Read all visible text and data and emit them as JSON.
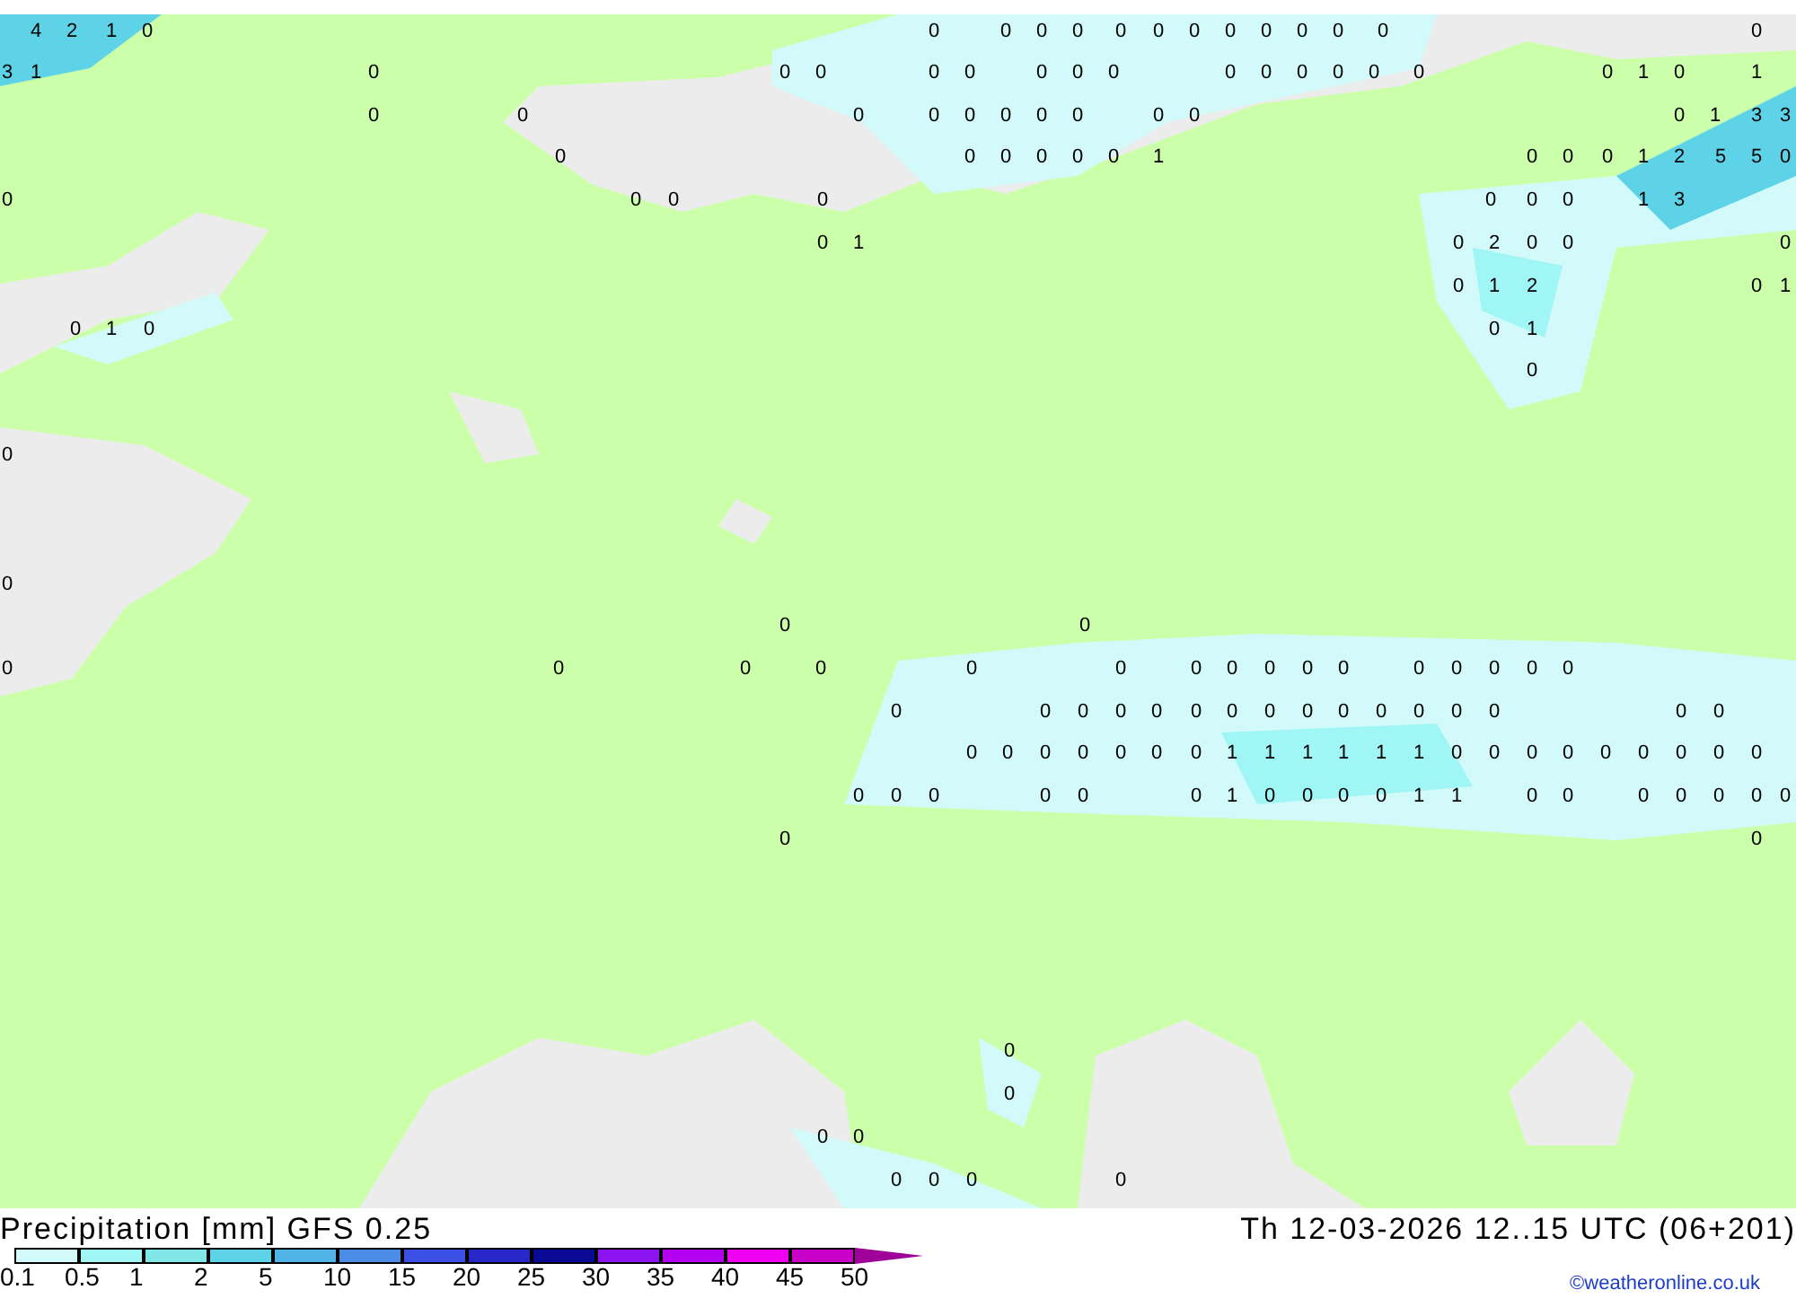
{
  "map_values": [
    {
      "values": [
        "4",
        "2",
        "1",
        "0",
        "0",
        "0",
        "0",
        "0",
        "0",
        "0",
        "0",
        "0",
        "0",
        "0",
        "0",
        "0",
        "0"
      ]
    },
    {
      "values": [
        "3",
        "1",
        "0",
        "0",
        "0",
        "0",
        "0",
        "0",
        "0",
        "0",
        "0",
        "0",
        "0",
        "0",
        "0",
        "0",
        "0",
        "1",
        "0",
        "1"
      ]
    },
    {
      "values": [
        "0",
        "0",
        "0",
        "0",
        "0",
        "0",
        "0",
        "0",
        "0",
        "0",
        "0",
        "1",
        "3",
        "3"
      ]
    },
    {
      "values": [
        "0",
        "0",
        "0",
        "0",
        "0",
        "0",
        "1",
        "0",
        "0",
        "0",
        "1",
        "2",
        "5",
        "5",
        "0"
      ]
    },
    {
      "values": [
        "0",
        "0",
        "0",
        "0",
        "0",
        "0",
        "0",
        "1",
        "3"
      ]
    },
    {
      "values": [
        "0",
        "1",
        "0",
        "2",
        "0",
        "0",
        "0"
      ]
    },
    {
      "values": [
        "0",
        "1",
        "2",
        "0",
        "1"
      ]
    },
    {
      "values": [
        "0",
        "1",
        "0",
        "0",
        "1"
      ]
    },
    {
      "values": [
        "0"
      ]
    },
    {
      "values": [
        "0"
      ]
    },
    {
      "values": [
        "0"
      ]
    },
    {
      "values": [
        "0",
        "0"
      ]
    },
    {
      "values": [
        "0",
        "0",
        "0",
        "0",
        "0",
        "0",
        "0",
        "0",
        "0",
        "0",
        "0",
        "0",
        "0",
        "0",
        "0",
        "0"
      ]
    },
    {
      "values": [
        "0",
        "0",
        "0",
        "0",
        "0",
        "0",
        "0",
        "0",
        "0",
        "0",
        "0",
        "0",
        "0",
        "0",
        "0",
        "0"
      ]
    },
    {
      "values": [
        "0",
        "0",
        "0",
        "0",
        "0",
        "0",
        "0",
        "1",
        "1",
        "1",
        "1",
        "1",
        "1",
        "0",
        "0",
        "0",
        "0",
        "0",
        "0",
        "0",
        "0",
        "0"
      ]
    },
    {
      "values": [
        "0",
        "0",
        "0",
        "0",
        "0",
        "0",
        "1",
        "0",
        "0",
        "0",
        "0",
        "1",
        "1",
        "0",
        "0",
        "0",
        "0",
        "0",
        "0",
        "0"
      ]
    },
    {
      "values": [
        "0",
        "0"
      ]
    },
    {
      "values": [
        "0"
      ]
    },
    {
      "values": [
        "0"
      ]
    },
    {
      "values": [
        "0",
        "0"
      ]
    },
    {
      "values": [
        "0",
        "0",
        "0",
        "0"
      ]
    }
  ],
  "legend": {
    "title": "Precipitation [mm] GFS 0.25",
    "time": "Th 12-03-2026 12..15 UTC (06+201)",
    "swatches": [
      {
        "color": "#d2fafa"
      },
      {
        "color": "#a0f5f5"
      },
      {
        "color": "#80e6e6"
      },
      {
        "color": "#5ed2e6"
      },
      {
        "color": "#50b4e6"
      },
      {
        "color": "#4b8ce6"
      },
      {
        "color": "#3c50e6"
      },
      {
        "color": "#2828c8"
      },
      {
        "color": "#0a0a96"
      },
      {
        "color": "#8c14f0"
      },
      {
        "color": "#b400f0"
      },
      {
        "color": "#f000f0"
      },
      {
        "color": "#c800c8"
      }
    ],
    "ticks": [
      "0.1",
      "0.5",
      "1",
      "2",
      "5",
      "10",
      "15",
      "20",
      "25",
      "30",
      "35",
      "40",
      "45",
      "50"
    ],
    "credit": "©weatheronline.co.uk"
  }
}
